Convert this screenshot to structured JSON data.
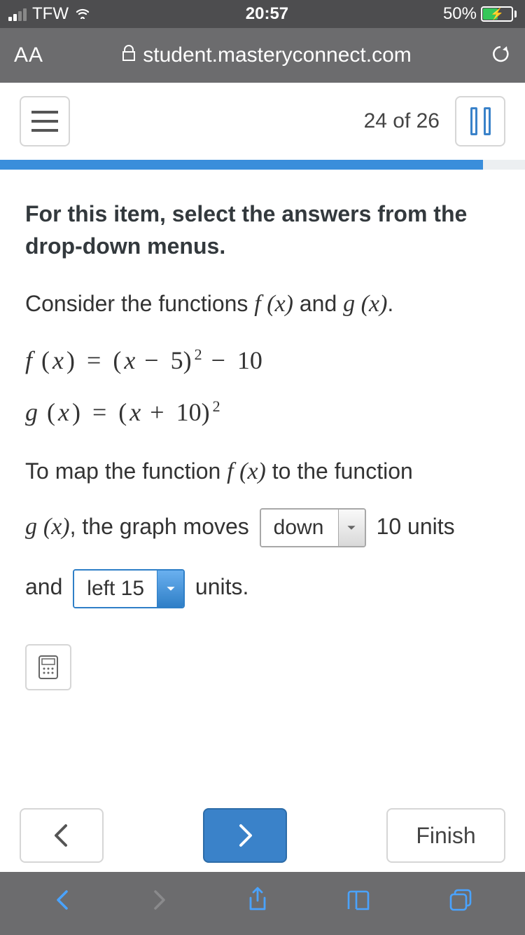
{
  "status": {
    "carrier": "TFW",
    "time": "20:57",
    "battery_pct": "50%"
  },
  "url_bar": {
    "aa": "AA",
    "domain": "student.masteryconnect.com"
  },
  "header": {
    "page_count": "24 of 26"
  },
  "progress": {
    "percent": 92
  },
  "content": {
    "instruction": "For this item, select the answers from the drop-down menus.",
    "prompt_prefix": "Consider the functions ",
    "fn_f": "f (x)",
    "and": " and ",
    "fn_g": "g (x)",
    "prompt_suffix": ".",
    "eq_f": "f (x) = (x − 5)² − 10",
    "eq_g": "g (x) = (x + 10)²",
    "q_line_prefix": "To map the function ",
    "q_line_middle": " to the function",
    "answer": {
      "p1": "g (x), the graph moves",
      "dd1": "down",
      "p2": "10 units",
      "p3": "and",
      "dd2": "left 15",
      "p4": "units."
    }
  },
  "nav": {
    "finish": "Finish"
  }
}
